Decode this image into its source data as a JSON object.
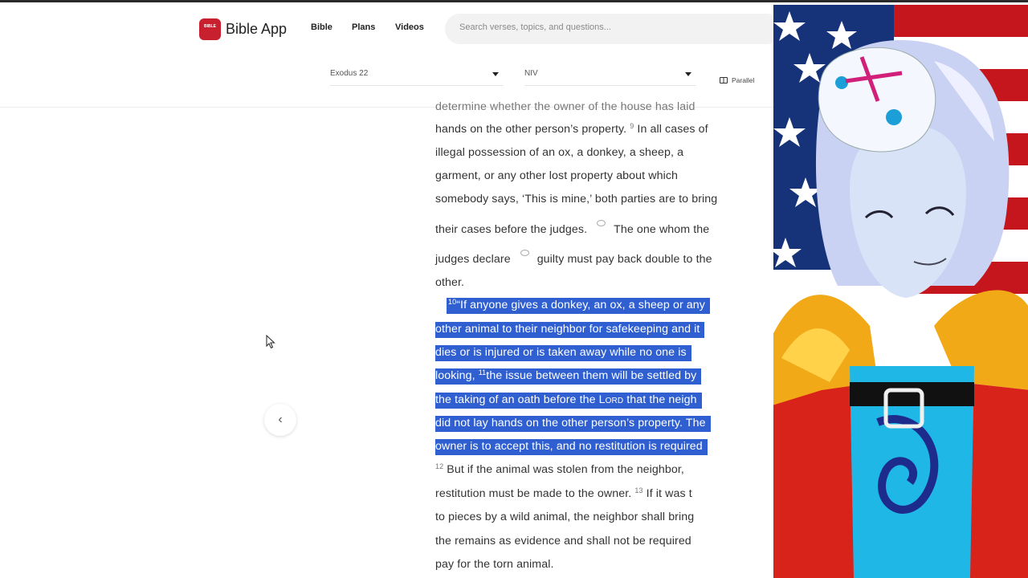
{
  "app": {
    "name": "Bible App",
    "logo_text": "BIBLE"
  },
  "nav": {
    "items": [
      "Bible",
      "Plans",
      "Videos"
    ]
  },
  "search": {
    "placeholder": "Search verses, topics, and questions..."
  },
  "selectors": {
    "book": "Exodus 22",
    "version": "NIV",
    "parallel_label": "Parallel"
  },
  "passage": {
    "lines": [
      "determine whether the owner of the house has laid",
      "hands on the other person’s property.",
      "9",
      "In all cases of",
      "illegal possession of an ox, a donkey, a sheep, a",
      "garment, or any other lost property about which",
      "somebody says, ‘This is mine,’ both parties are to bring",
      "their cases before the judges.",
      "The one whom the",
      "judges declare",
      "guilty must pay back double to the",
      "other."
    ],
    "highlighted": [
      "10",
      "“If anyone gives a donkey, an ox, a sheep or any",
      "other animal to their neighbor for safekeeping and it",
      "dies or is injured or is taken away while no one is",
      "looking,",
      "11",
      "the issue between them will be settled by",
      "the taking of an oath before the",
      "Lord",
      "that the neigh",
      "did not lay hands on the other person’s property. The",
      "owner is to accept this, and no restitution is required"
    ],
    "after": [
      "12",
      "But if the animal was stolen from the neighbor,",
      "restitution must be made to the owner.",
      "13",
      "If it was t",
      "to pieces by a wild animal, the neighbor shall bring",
      "the remains as evidence and shall not be required",
      "pay for the torn animal."
    ]
  },
  "colors": {
    "highlight": "#2f5fd0",
    "logo": "#c8202f"
  }
}
